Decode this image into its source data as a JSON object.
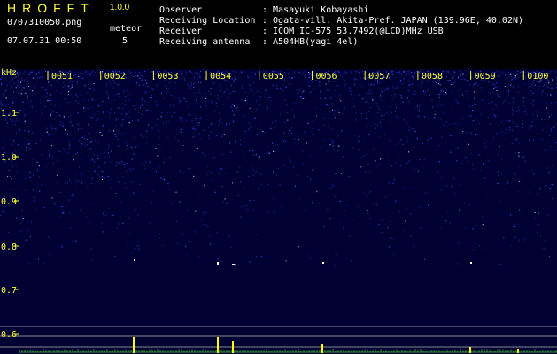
{
  "header": {
    "title": "HROFFT",
    "version": "1.0.0",
    "filename": "0707310050.png",
    "datetime": "07.07.31 00:50",
    "meteor_label": "meteor",
    "meteor_count": "5"
  },
  "info": {
    "observer_label": "Observer",
    "observer_value": ": Masayuki Kobayashi",
    "location_label": "Receiving Location",
    "location_value": ": Ogata-vill. Akita-Pref. JAPAN (139.96E, 40.02N)",
    "receiver_label": "Receiver",
    "receiver_value": ": ICOM IC-575 53.7492(@LCD)MHz USB",
    "antenna_label": "Receiving antenna",
    "antenna_value": ": A504HB(yagi 4el)"
  },
  "chart_data": {
    "type": "heatmap",
    "ylabel": "kHz",
    "x_ticks": [
      "0051",
      "0052",
      "0053",
      "0054",
      "0055",
      "0056",
      "0057",
      "0058",
      "0059",
      "0100"
    ],
    "y_ticks": [
      "1.1",
      "1.0",
      "0.9",
      "0.8",
      "0.7",
      "0.6"
    ],
    "colors": {
      "background": "#000033",
      "noise": "#2f55ff",
      "signal": "#ffffff",
      "text_yellow": "#ffff33",
      "amplitude": "#ffff00"
    }
  }
}
